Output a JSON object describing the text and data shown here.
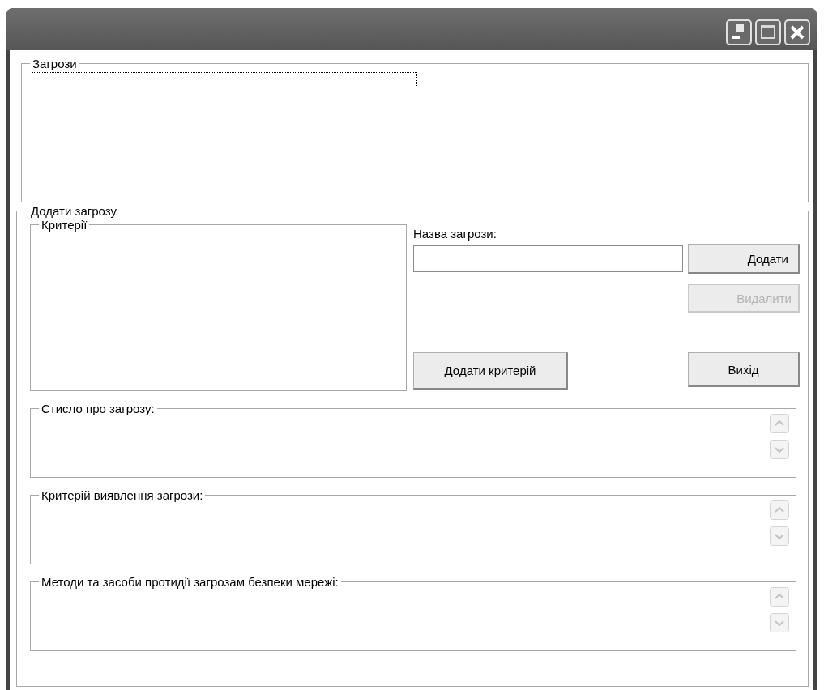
{
  "window": {
    "title_buttons": [
      {
        "kind": "minimize"
      },
      {
        "kind": "maximize"
      },
      {
        "kind": "close"
      }
    ]
  },
  "threats_group": {
    "title": "Загрози",
    "list": {
      "focused": true
    }
  },
  "add_group": {
    "title": "Додати загрозу",
    "criteria_group": {
      "title": "Критерії"
    },
    "name_label": "Назва загрози:",
    "buttons": [
      {
        "kind": "add",
        "label": "Додати",
        "disabled": false
      },
      {
        "kind": "delete",
        "label": "Видалити",
        "disabled": true
      },
      {
        "kind": "add_criterion",
        "label": "Додати критерій",
        "disabled": false
      },
      {
        "kind": "exit",
        "label": "Вихід",
        "disabled": false
      }
    ],
    "memos": [
      {
        "title": "Стисло про загрозу:"
      },
      {
        "title": "Критерій виявлення загрози:"
      },
      {
        "title": "Методи та засоби протидії загрозам безпеки мережі:"
      }
    ]
  }
}
